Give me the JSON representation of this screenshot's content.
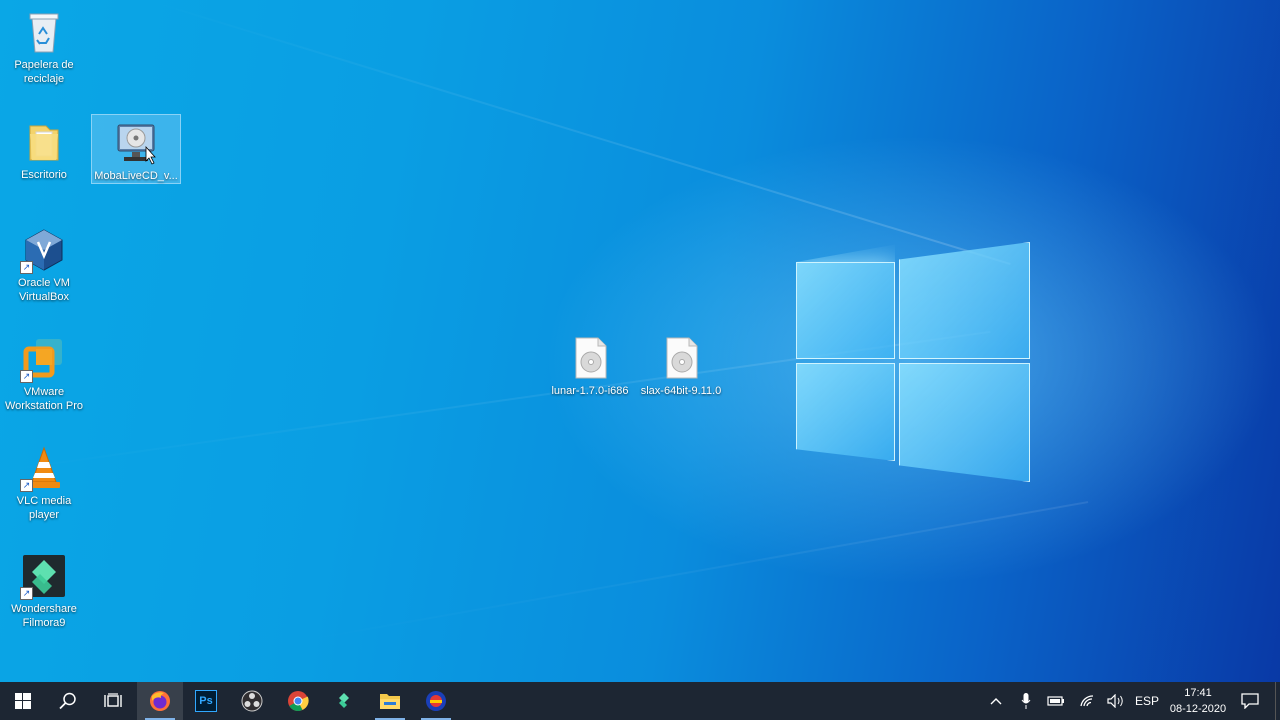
{
  "desktop": {
    "icons": [
      {
        "label": "Papelera de reciclaje",
        "icon": "recycle-bin-icon"
      },
      {
        "label": "Escritorio",
        "icon": "folder-icon"
      },
      {
        "label": "MobaLiveCD_v...",
        "icon": "mobalivecd-icon"
      },
      {
        "label": "Oracle VM VirtualBox",
        "icon": "virtualbox-icon"
      },
      {
        "label": "VMware Workstation Pro",
        "icon": "vmware-icon"
      },
      {
        "label": "VLC media player",
        "icon": "vlc-icon"
      },
      {
        "label": "Wondershare Filmora9",
        "icon": "filmora-icon"
      },
      {
        "label": "lunar-1.7.0-i686",
        "icon": "iso-file-icon"
      },
      {
        "label": "slax-64bit-9.11.0",
        "icon": "iso-file-icon"
      }
    ],
    "selected_icon": "MobaLiveCD_v..."
  },
  "taskbar": {
    "apps": [
      {
        "name": "start-button",
        "icon": "windows-logo-icon"
      },
      {
        "name": "search-button",
        "icon": "search-icon"
      },
      {
        "name": "task-view-button",
        "icon": "task-view-icon"
      },
      {
        "name": "firefox",
        "icon": "firefox-icon"
      },
      {
        "name": "photoshop",
        "icon": "photoshop-icon",
        "text": "Ps"
      },
      {
        "name": "obs",
        "icon": "obs-icon"
      },
      {
        "name": "chrome",
        "icon": "chrome-icon"
      },
      {
        "name": "filmora",
        "icon": "filmora-icon"
      },
      {
        "name": "file-explorer",
        "icon": "folder-icon"
      },
      {
        "name": "recorder",
        "icon": "recorder-icon"
      }
    ],
    "tray": {
      "language": "ESP",
      "time": "17:41",
      "date": "08-12-2020"
    }
  },
  "colors": {
    "taskbar_bg": "#1d2633",
    "desktop_blue": "#0a9ee3"
  }
}
